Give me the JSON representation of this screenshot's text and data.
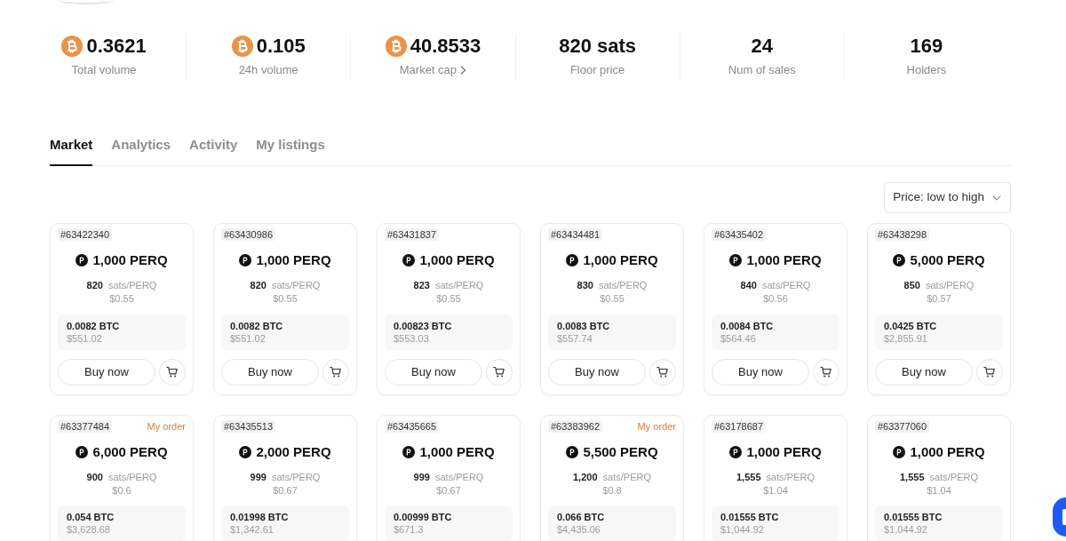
{
  "stats": [
    {
      "kind": "btc",
      "value": "0.3621",
      "label": "Total volume",
      "linked": false
    },
    {
      "kind": "btc",
      "value": "0.105",
      "label": "24h volume",
      "linked": false
    },
    {
      "kind": "btc",
      "value": "40.8533",
      "label": "Market cap",
      "linked": true
    },
    {
      "kind": "plain",
      "value": "820 sats",
      "label": "Floor price",
      "linked": false
    },
    {
      "kind": "plain",
      "value": "24",
      "label": "Num of sales",
      "linked": false
    },
    {
      "kind": "plain",
      "value": "169",
      "label": "Holders",
      "linked": false
    }
  ],
  "tabs": [
    {
      "label": "Market",
      "selected": true
    },
    {
      "label": "Analytics",
      "selected": false
    },
    {
      "label": "Activity",
      "selected": false
    },
    {
      "label": "My listings",
      "selected": false
    }
  ],
  "sort": {
    "label": "Price: low to high"
  },
  "listings": [
    {
      "id": "#63422340",
      "amount": "1,000 PERQ",
      "unit_price": "820",
      "unit": "sats/PERQ",
      "unit_usd": "$0.55",
      "total_btc": "0.0082 BTC",
      "total_usd": "$551.02",
      "buy_label": "Buy now"
    },
    {
      "id": "#63430986",
      "amount": "1,000 PERQ",
      "unit_price": "820",
      "unit": "sats/PERQ",
      "unit_usd": "$0.55",
      "total_btc": "0.0082 BTC",
      "total_usd": "$551.02",
      "buy_label": "Buy now"
    },
    {
      "id": "#63431837",
      "amount": "1,000 PERQ",
      "unit_price": "823",
      "unit": "sats/PERQ",
      "unit_usd": "$0.55",
      "total_btc": "0.00823 BTC",
      "total_usd": "$553.03",
      "buy_label": "Buy now"
    },
    {
      "id": "#63434481",
      "amount": "1,000 PERQ",
      "unit_price": "830",
      "unit": "sats/PERQ",
      "unit_usd": "$0.55",
      "total_btc": "0.0083 BTC",
      "total_usd": "$557.74",
      "buy_label": "Buy now"
    },
    {
      "id": "#63435402",
      "amount": "1,000 PERQ",
      "unit_price": "840",
      "unit": "sats/PERQ",
      "unit_usd": "$0.56",
      "total_btc": "0.0084 BTC",
      "total_usd": "$564.46",
      "buy_label": "Buy now"
    },
    {
      "id": "#63438298",
      "amount": "5,000 PERQ",
      "unit_price": "850",
      "unit": "sats/PERQ",
      "unit_usd": "$0.57",
      "total_btc": "0.0425 BTC",
      "total_usd": "$2,855.91",
      "buy_label": "Buy now"
    },
    {
      "id": "#63377484",
      "tag": "My order",
      "amount": "6,000 PERQ",
      "unit_price": "900",
      "unit": "sats/PERQ",
      "unit_usd": "$0.6",
      "total_btc": "0.054 BTC",
      "total_usd": "$3,628.68"
    },
    {
      "id": "#63435513",
      "amount": "2,000 PERQ",
      "unit_price": "999",
      "unit": "sats/PERQ",
      "unit_usd": "$0.67",
      "total_btc": "0.01998 BTC",
      "total_usd": "$1,342.61"
    },
    {
      "id": "#63435665",
      "amount": "1,000 PERQ",
      "unit_price": "999",
      "unit": "sats/PERQ",
      "unit_usd": "$0.67",
      "total_btc": "0.00999 BTC",
      "total_usd": "$671.3"
    },
    {
      "id": "#63383962",
      "tag": "My order",
      "amount": "5,500 PERQ",
      "unit_price": "1,200",
      "unit": "sats/PERQ",
      "unit_usd": "$0.8",
      "total_btc": "0.066 BTC",
      "total_usd": "$4,435.06"
    },
    {
      "id": "#63178687",
      "amount": "1,000 PERQ",
      "unit_price": "1,555",
      "unit": "sats/PERQ",
      "unit_usd": "$1.04",
      "total_btc": "0.01555 BTC",
      "total_usd": "$1,044.92"
    },
    {
      "id": "#63377060",
      "amount": "1,000 PERQ",
      "unit_price": "1,555",
      "unit": "sats/PERQ",
      "unit_usd": "$1.04",
      "total_btc": "0.01555 BTC",
      "total_usd": "$1,044.92"
    }
  ]
}
